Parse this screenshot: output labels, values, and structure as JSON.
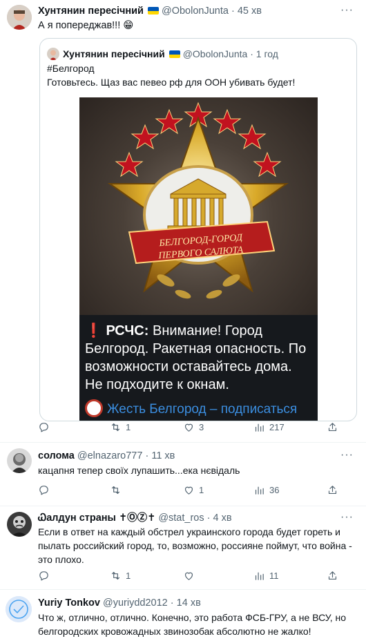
{
  "tweets": {
    "main": {
      "name": "Хунтянин пересічний",
      "handle": "@ObolonJunta",
      "separator": "·",
      "time": "45 хв",
      "text": "А я попереджав!!! 😁",
      "quote": {
        "name": "Хунтянин пересічний",
        "handle": "@ObolonJunta",
        "time": "1 год",
        "hashtag": "#Белгород",
        "text": "Готовьтесь. Щаз вас певео рф для ООН убивать будет!",
        "image": {
          "badge_line1": "БЕЛГОРОД-ГОРОД",
          "badge_line2": "ПЕРВОГО САЛЮТА",
          "alert_emoji": "❗",
          "alert_source": "РСЧС:",
          "alert_text": " Внимание!  Город Белгород. Ракетная опасность. По возможности оставайтесь дома. Не подходите к окнам.",
          "footer_text": "Жесть Белгород – подписаться"
        }
      },
      "retweets": "1",
      "likes": "3",
      "views": "217"
    },
    "reply1": {
      "name": "солома",
      "handle": "@elnazaro777",
      "separator": "·",
      "time": "11 хв",
      "text": "кацапня тепер своїх лупашить...ека нєвідаль",
      "likes": "1",
      "views": "36"
    },
    "reply2": {
      "name": "Ꮗалдун страны ✝ⓄⓏ✝",
      "handle": "@stat_ros",
      "separator": "·",
      "time": "4 хв",
      "text": "Если в ответ на каждый обстрел украинского города будет гореть и пылать российский город, то, возможно, россияне поймут, что война - это плохо.",
      "retweets": "1",
      "views": "11"
    },
    "reply3": {
      "name": "Yuriy Tonkov",
      "handle": "@yuriydd2012",
      "separator": "·",
      "time": "14 хв",
      "text": "Что ж, отлично, отлично. Конечно, это работа ФСБ-ГРУ, а не  ВСУ, но белгородских кровожадных звинозобак абсолютно не жалко!"
    }
  },
  "more_label": "···",
  "colors": {
    "text": "#0f1419",
    "secondary": "#536471",
    "border": "#cfd9de",
    "ukraine_blue": "#0057b7",
    "ukraine_yellow": "#ffd700"
  }
}
